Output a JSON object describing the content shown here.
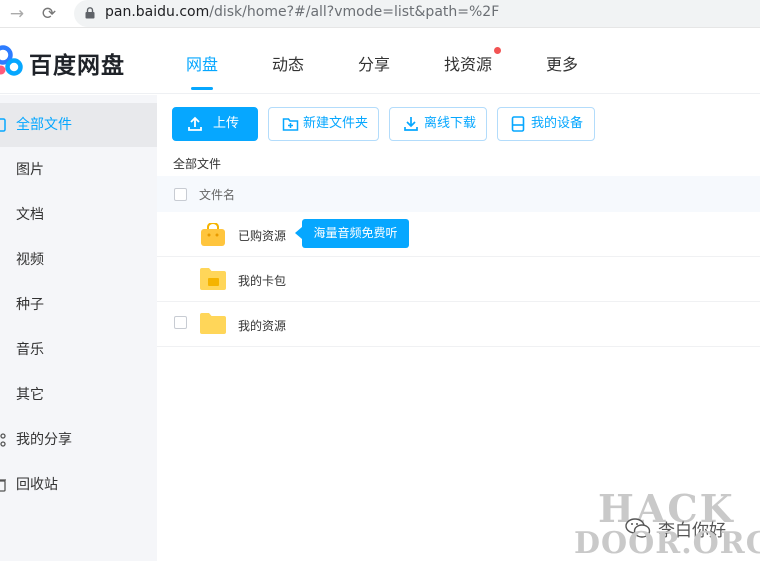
{
  "browser": {
    "url_host": "pan.baidu.com",
    "url_path": "/disk/home?#/all?vmode=list&path=%2F"
  },
  "header": {
    "logo_text": "百度网盘",
    "tabs": [
      {
        "label": "网盘",
        "active": true
      },
      {
        "label": "动态",
        "active": false
      },
      {
        "label": "分享",
        "active": false
      },
      {
        "label": "找资源",
        "active": false,
        "badge": "red-dot"
      },
      {
        "label": "更多",
        "active": false
      }
    ]
  },
  "sidebar": {
    "items": [
      {
        "label": "全部文件",
        "active": true,
        "icon": "file-icon"
      },
      {
        "label": "图片"
      },
      {
        "label": "文档"
      },
      {
        "label": "视频"
      },
      {
        "label": "种子"
      },
      {
        "label": "音乐"
      },
      {
        "label": "其它"
      },
      {
        "label": "我的分享",
        "icon": "share-icon"
      },
      {
        "label": "回收站",
        "icon": "trash-icon"
      }
    ]
  },
  "toolbar": {
    "upload_label": "上传",
    "new_folder_label": "新建文件夹",
    "offline_download_label": "离线下载",
    "my_devices_label": "我的设备"
  },
  "breadcrumb": "全部文件",
  "file_list": {
    "column_name": "文件名",
    "rows": [
      {
        "name": "已购资源",
        "icon": "purchased-bag-icon"
      },
      {
        "name": "我的卡包",
        "icon": "card-wallet-folder-icon"
      },
      {
        "name": "我的资源",
        "icon": "folder-icon"
      }
    ]
  },
  "tooltip": "海量音频免费听",
  "watermark": {
    "line1": "HACK",
    "line2": "DOOR.ORG",
    "author": "李白你好"
  },
  "colors": {
    "accent": "#06a7ff",
    "badge": "#f25353",
    "folder": "#ffd659"
  }
}
